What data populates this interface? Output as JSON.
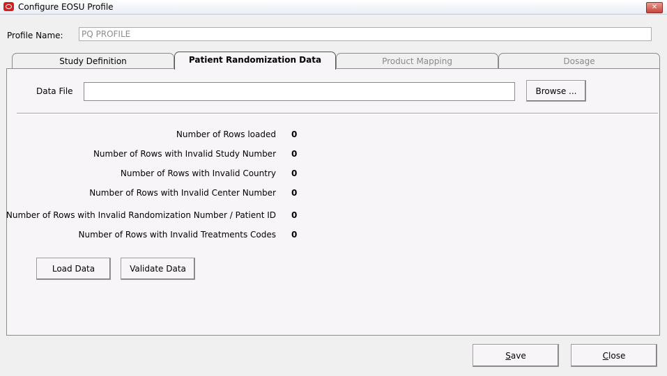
{
  "window": {
    "title": "Configure EOSU Profile",
    "close_glyph": "✕",
    "accent_color": "#d21f1f"
  },
  "profile": {
    "label": "Profile Name:",
    "value": "PQ PROFILE"
  },
  "tabs": [
    {
      "label": "Study Definition",
      "state": "enabled"
    },
    {
      "label": "Patient Randomization Data",
      "state": "active"
    },
    {
      "label": "Product Mapping",
      "state": "disabled"
    },
    {
      "label": "Dosage",
      "state": "disabled"
    }
  ],
  "data_file": {
    "label": "Data File",
    "value": "",
    "browse_label": "Browse ..."
  },
  "stats": [
    {
      "label": "Number of Rows loaded",
      "value": "0"
    },
    {
      "label": "Number of Rows with Invalid Study Number",
      "value": "0"
    },
    {
      "label": "Number of Rows with Invalid Country",
      "value": "0"
    },
    {
      "label": "Number of Rows with Invalid Center Number",
      "value": "0"
    },
    {
      "label": "Number of Rows with Invalid Randomization Number / Patient ID",
      "value": "0"
    },
    {
      "label": "Number of Rows with Invalid Treatments Codes",
      "value": "0"
    }
  ],
  "actions": {
    "load_label": "Load Data",
    "validate_label": "Validate Data"
  },
  "footer": {
    "save_mnemonic": "S",
    "save_rest": "ave",
    "close_mnemonic": "C",
    "close_rest": "lose"
  }
}
